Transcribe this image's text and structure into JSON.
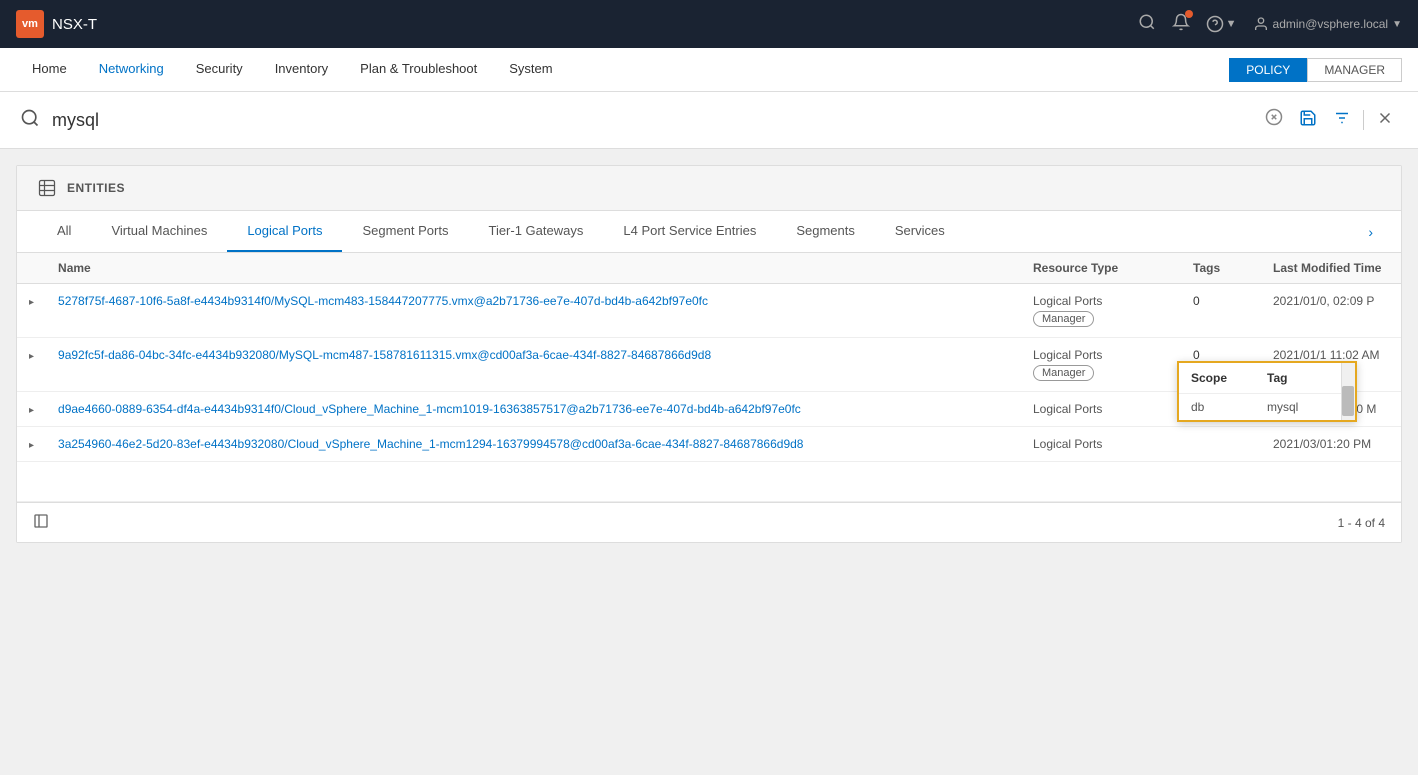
{
  "topbar": {
    "logo_text": "vm",
    "title": "NSX-T",
    "user_label": "admin@vsphere.local",
    "icons": {
      "search": "🔍",
      "bell": "🔔",
      "help": "?",
      "chevron": "▼"
    }
  },
  "navbar": {
    "items": [
      {
        "id": "home",
        "label": "Home",
        "active": false
      },
      {
        "id": "networking",
        "label": "Networking",
        "active": false
      },
      {
        "id": "security",
        "label": "Security",
        "active": false
      },
      {
        "id": "inventory",
        "label": "Inventory",
        "active": false
      },
      {
        "id": "plan-troubleshoot",
        "label": "Plan & Troubleshoot",
        "active": false
      },
      {
        "id": "system",
        "label": "System",
        "active": false
      }
    ],
    "policy_btn": "POLICY",
    "manager_btn": "MANAGER"
  },
  "search": {
    "placeholder": "Search",
    "value": "mysql",
    "clear_label": "×",
    "save_label": "💾",
    "filter_label": "⚙",
    "close_label": "×"
  },
  "entities": {
    "label": "ENTITIES",
    "tabs": [
      {
        "id": "all",
        "label": "All",
        "active": false
      },
      {
        "id": "virtual-machines",
        "label": "Virtual Machines",
        "active": false
      },
      {
        "id": "logical-ports",
        "label": "Logical Ports",
        "active": true
      },
      {
        "id": "segment-ports",
        "label": "Segment Ports",
        "active": false
      },
      {
        "id": "tier1-gateways",
        "label": "Tier-1 Gateways",
        "active": false
      },
      {
        "id": "l4-port-service",
        "label": "L4 Port Service Entries",
        "active": false
      },
      {
        "id": "segments",
        "label": "Segments",
        "active": false
      },
      {
        "id": "services",
        "label": "Services",
        "active": false
      }
    ]
  },
  "table": {
    "columns": {
      "name": "Name",
      "resource_type": "Resource Type",
      "tags": "Tags",
      "last_modified": "Last Modified Time"
    },
    "rows": [
      {
        "id": "row1",
        "name": "5278f75f-4687-10f6-5a8f-e4434b9314f0/MySQL-mcm483-158447207775.vmx@a2b71736-ee7e-407d-bd4b-a642bf97e0fc",
        "resource_type": "Logical Ports",
        "badge": "Manager",
        "tags": "0",
        "tags_count": 0,
        "last_modified": "2021/01/0, 02:09 P"
      },
      {
        "id": "row2",
        "name": "9a92fc5f-da86-04bc-34fc-e4434b932080/MySQL-mcm487-158781611315.vmx@cd00af3a-6cae-434f-8827-84687866d9d8",
        "resource_type": "Logical Ports",
        "badge": "Manager",
        "tags": "0",
        "tags_count": 0,
        "last_modified": "2021/01/1 11:02 AM"
      },
      {
        "id": "row3",
        "name": "d9ae4660-0889-6354-df4a-e4434b9314f0/Cloud_vSphere_Machine_1-mcm1019-16363857517@a2b71736-ee7e-407d-bd4b-a642bf97e0fc",
        "resource_type": "Logical Ports",
        "badge": null,
        "tags": "1",
        "tags_count": 1,
        "last_modified": "2021/03/8, 04:30 M"
      },
      {
        "id": "row4",
        "name": "3a254960-46e2-5d20-83ef-e4434b932080/Cloud_vSphere_Machine_1-mcm1294-16379994578@cd00af3a-6cae-434f-8827-84687866d9d8",
        "resource_type": "Logical Ports",
        "badge": null,
        "tags": "",
        "tags_count": null,
        "last_modified": "2021/03/01:20 PM"
      }
    ]
  },
  "tooltip": {
    "scope_label": "Scope",
    "tag_label": "Tag",
    "rows": [
      {
        "scope": "db",
        "tag": "mysql"
      }
    ]
  },
  "footer": {
    "pagination": "1 - 4 of 4"
  }
}
